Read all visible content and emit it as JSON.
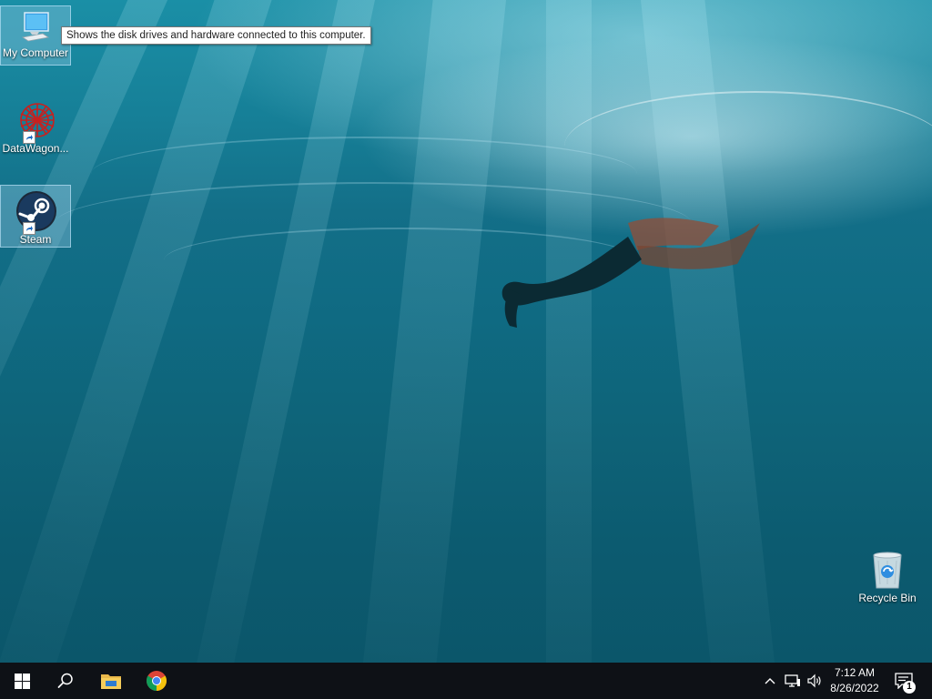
{
  "desktop": {
    "icons": [
      {
        "label": "My Computer",
        "icon": "monitor-icon"
      },
      {
        "label": "DataWagon...",
        "icon": "datawagon-icon"
      },
      {
        "label": "Steam",
        "icon": "steam-icon"
      },
      {
        "label": "Recycle Bin",
        "icon": "recycle-bin-icon"
      }
    ],
    "tooltip": "Shows the disk drives and hardware connected to this computer."
  },
  "taskbar": {
    "start": {
      "icon": "windows-logo-icon"
    },
    "search": {
      "icon": "search-icon"
    },
    "pinned": [
      {
        "name": "File Explorer",
        "icon": "folder-icon"
      },
      {
        "name": "Google Chrome",
        "icon": "chrome-icon"
      }
    ],
    "tray": {
      "chevron_icon": "chevron-up-icon",
      "network_icon": "network-icon",
      "volume_icon": "speaker-icon",
      "time": "7:12 AM",
      "date": "8/26/2022",
      "notifications_count": "1",
      "notifications_icon": "action-center-icon"
    }
  },
  "colors": {
    "taskbar": "#0e1116",
    "water_top": "#1a8fa6",
    "water_bottom": "#0b566a",
    "selection": "#a0d2eb"
  }
}
